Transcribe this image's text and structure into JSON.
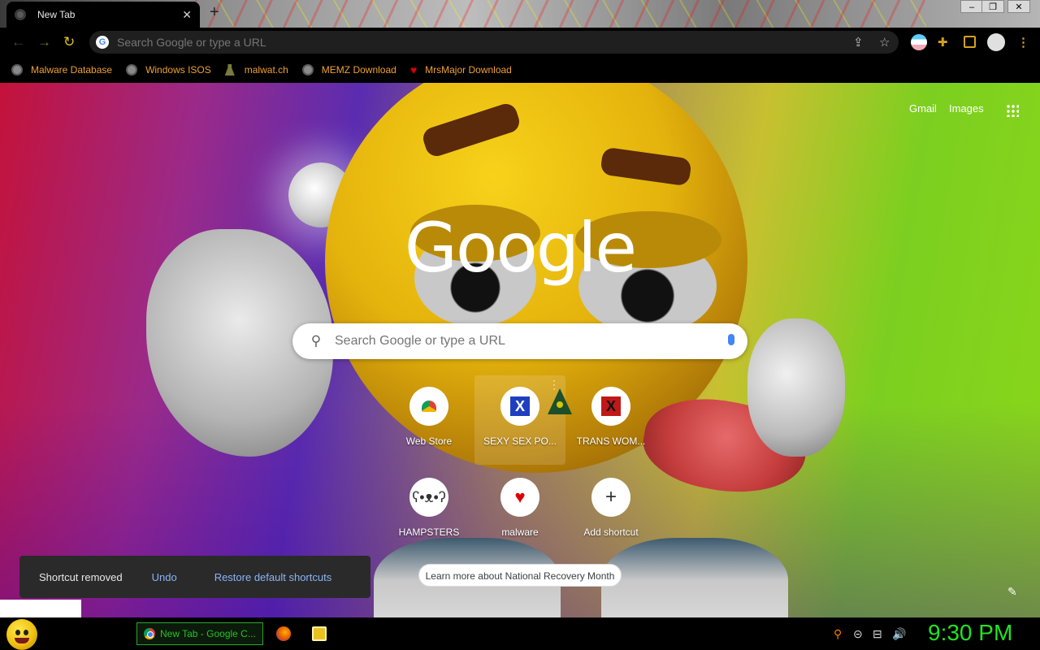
{
  "window": {
    "tab_title": "New Tab",
    "new_tab_symbol": "+",
    "controls": [
      "–",
      "❐",
      "✕"
    ]
  },
  "toolbar": {
    "omnibox_placeholder": "Search Google or type a URL"
  },
  "bookmarks": [
    {
      "label": "Malware Database",
      "icon": "globe-icon"
    },
    {
      "label": "Windows ISOS",
      "icon": "globe-icon"
    },
    {
      "label": "malwat.ch",
      "icon": "person-icon"
    },
    {
      "label": "MEMZ Download",
      "icon": "globe-icon"
    },
    {
      "label": "MrsMajor Download",
      "icon": "heart-icon"
    }
  ],
  "ntp": {
    "top_links": {
      "gmail": "Gmail",
      "images": "Images"
    },
    "logo": "Google",
    "search_placeholder": "Search Google or type a URL",
    "shortcuts": [
      {
        "label": "Web Store",
        "icon": "chrome-store-icon"
      },
      {
        "label": "SEXY SEX PO...",
        "icon": "x-icon"
      },
      {
        "label": "TRANS WOM...",
        "icon": "x-icon"
      },
      {
        "label": "HAMPSTERS",
        "icon": "hamster-icon"
      },
      {
        "label": "malware",
        "icon": "heart-icon"
      },
      {
        "label": "Add shortcut",
        "icon": "plus-icon"
      }
    ],
    "toast": {
      "message": "Shortcut removed",
      "undo": "Undo",
      "restore": "Restore default shortcuts"
    },
    "promo": "Learn more about National Recovery Month"
  },
  "taskbar": {
    "task_label": "New Tab - Google C...",
    "clock": "9:30 PM"
  },
  "colors": {
    "bookmark_text": "#f0a030",
    "toast_link": "#8ab4f8",
    "clock": "#22e322",
    "taskbar_task": "#22c322"
  }
}
